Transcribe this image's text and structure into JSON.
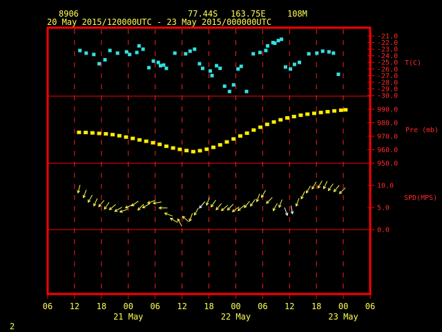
{
  "header": {
    "station_id": "8906",
    "latitude": "77.44S",
    "longitude": "163.75E",
    "elevation": "108M",
    "period": "20 May 2015/120000UTC - 23 May 2015/000000UTC"
  },
  "footer": {
    "page_number": "2"
  },
  "colors": {
    "frame": "#ff0000",
    "grid": "#ff2020",
    "temperature": "#33e0e0",
    "pressure": "#ffee00",
    "wind": "#ffff55",
    "wind_highlight": "#ffffff"
  },
  "x_axis": {
    "hour_ticks": [
      "06",
      "12",
      "18",
      "00",
      "06",
      "12",
      "18",
      "00",
      "06",
      "12",
      "18",
      "00",
      "06"
    ],
    "day_labels": [
      "21 May",
      "22 May",
      "23 May"
    ]
  },
  "panels": {
    "temperature": {
      "label": "T(C)",
      "ticks": [
        "-21.0",
        "-22.0",
        "-23.0",
        "-24.0",
        "-25.0",
        "-26.0",
        "-27.0",
        "-28.0",
        "-29.0",
        "-30.0"
      ]
    },
    "pressure": {
      "label": "Pre (mb)",
      "ticks": [
        "990.0",
        "980.0",
        "970.0",
        "960.0",
        "950.0"
      ]
    },
    "wind": {
      "label": "SPD(MPS)",
      "ticks": [
        "10.0",
        "5.0",
        "0.0"
      ]
    }
  },
  "chart_data": [
    {
      "type": "scatter",
      "title": "",
      "xlabel": "",
      "ylabel": "T(C)",
      "x_unit": "hours since 20 May 2015 00 UTC",
      "xlim": [
        6,
        78
      ],
      "ylim": [
        -30,
        -20.6
      ],
      "grid": true,
      "x": [
        13.2,
        14.6,
        16.3,
        17.5,
        18.8,
        19.9,
        21.6,
        23.6,
        24.3,
        25.9,
        26.4,
        27.3,
        28.6,
        29.6,
        30.7,
        31.2,
        31.9,
        32.5,
        34.4,
        36.8,
        37.8,
        38.8,
        39.9,
        40.6,
        42.3,
        42.7,
        43.7,
        44.5,
        45.5,
        46.6,
        47.5,
        48.5,
        49.2,
        50.4,
        51.9,
        53.4,
        54.7,
        55.1,
        56.3,
        56.7,
        57.5,
        58.2,
        59.1,
        60.2,
        61.1,
        62.2,
        64.3,
        66.1,
        67.4,
        68.8,
        69.8,
        70.9
      ],
      "values": [
        -23.2,
        -23.6,
        -23.8,
        -25.2,
        -24.6,
        -23.2,
        -23.6,
        -23.4,
        -23.8,
        -23.5,
        -22.5,
        -23.0,
        -25.8,
        -24.8,
        -25.0,
        -25.5,
        -25.4,
        -25.9,
        -23.6,
        -23.7,
        -23.3,
        -23.0,
        -25.2,
        -25.9,
        -26.3,
        -27.0,
        -25.5,
        -25.9,
        -28.6,
        -29.4,
        -28.4,
        -26.0,
        -25.6,
        -29.4,
        -23.7,
        -23.5,
        -23.2,
        -22.5,
        -22.0,
        -22.1,
        -21.7,
        -21.5,
        -25.7,
        -26.0,
        -25.3,
        -25.0,
        -23.7,
        -23.6,
        -23.3,
        -23.4,
        -23.6,
        -26.8
      ]
    },
    {
      "type": "scatter",
      "title": "",
      "xlabel": "",
      "ylabel": "Pre (mb)",
      "x_unit": "hours since 20 May 2015 00 UTC",
      "xlim": [
        6,
        78
      ],
      "ylim": [
        950,
        990
      ],
      "grid": true,
      "x": [
        13,
        14.5,
        16,
        17.5,
        19,
        20.5,
        22,
        23.5,
        25,
        26.5,
        28,
        29.5,
        31,
        32.5,
        34,
        35.5,
        37,
        38.5,
        40,
        41.5,
        43,
        44.5,
        46,
        47.5,
        49,
        50.5,
        52,
        53.5,
        55,
        56.5,
        58,
        59.5,
        61,
        62.5,
        64,
        65.5,
        67,
        68.5,
        70,
        71.5,
        72.5
      ],
      "values": [
        972.9,
        972.8,
        972.5,
        972.1,
        971.8,
        971.2,
        970.4,
        969.4,
        968.4,
        967.3,
        966.3,
        965.2,
        964.0,
        962.6,
        961.3,
        960.3,
        959.4,
        958.6,
        959.3,
        960.4,
        961.8,
        963.6,
        965.8,
        968.0,
        970.2,
        972.3,
        974.6,
        976.7,
        978.8,
        980.6,
        982.2,
        983.6,
        984.6,
        985.6,
        986.4,
        987.0,
        987.6,
        988.2,
        988.8,
        989.3,
        989.6
      ]
    },
    {
      "type": "scatter",
      "title": "",
      "xlabel": "",
      "ylabel": "SPD(MPS)",
      "x_unit": "hours since 20 May 2015 00 UTC",
      "xlim": [
        6,
        78
      ],
      "ylim": [
        -5,
        15
      ],
      "grid": true,
      "x": [
        13,
        14.3,
        15.5,
        16.7,
        18,
        19.2,
        20.5,
        21.8,
        23,
        24.2,
        25.5,
        26.8,
        28,
        29.2,
        30.5,
        31.8,
        33,
        34.2,
        35.5,
        36.8,
        38,
        39.2,
        40.5,
        41.8,
        43,
        44.2,
        45.5,
        46.8,
        48,
        49.2,
        50.5,
        51.8,
        53,
        54.2,
        55.5,
        56.8,
        58,
        59.2,
        60.5,
        61.8,
        63,
        64.2,
        65.5,
        66.8,
        68,
        69.2,
        70.5,
        71.8
      ],
      "values": [
        9.2,
        8.1,
        7.0,
        6.2,
        5.9,
        5.4,
        5.1,
        4.6,
        4.3,
        5.3,
        5.9,
        5.1,
        5.4,
        6.3,
        6.1,
        4.9,
        3.4,
        2.1,
        1.6,
        2.4,
        2.8,
        4.1,
        5.6,
        6.4,
        5.9,
        5.2,
        4.9,
        5.1,
        4.6,
        4.9,
        5.7,
        6.1,
        7.2,
        8.1,
        6.6,
        5.1,
        5.9,
        4.1,
        4.5,
        6.2,
        7.8,
        9.1,
        10.0,
        10.2,
        10.1,
        9.6,
        9.3,
        8.8
      ],
      "direction_deg": [
        195,
        200,
        210,
        205,
        220,
        215,
        230,
        240,
        250,
        245,
        235,
        225,
        240,
        250,
        260,
        270,
        290,
        300,
        330,
        310,
        200,
        210,
        220,
        200,
        215,
        220,
        230,
        225,
        235,
        230,
        220,
        215,
        200,
        210,
        225,
        210,
        200,
        160,
        170,
        200,
        205,
        210,
        210,
        210,
        205,
        215,
        220,
        225
      ],
      "highlight_x": [
        40.5,
        59.2,
        60.5
      ]
    }
  ]
}
